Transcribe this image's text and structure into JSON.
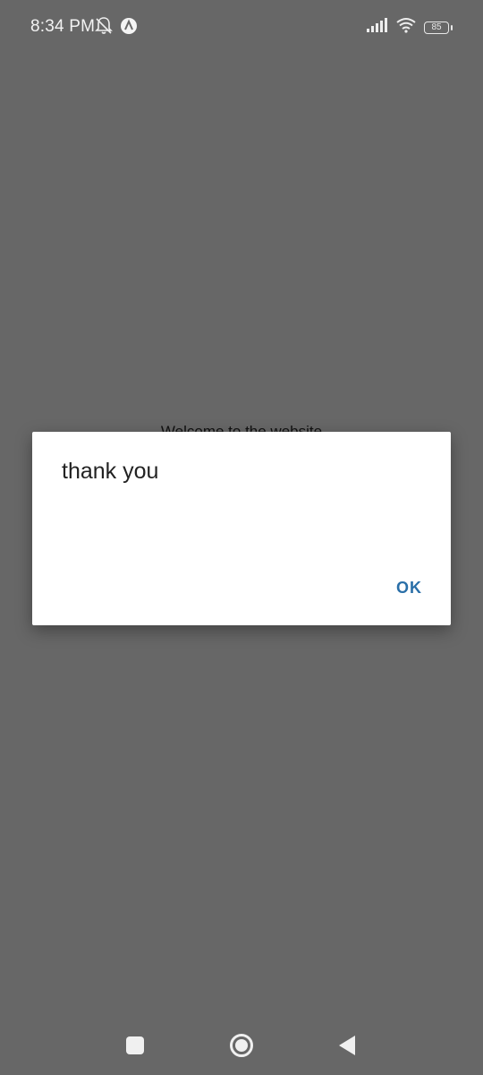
{
  "status_bar": {
    "time": "8:34 PM",
    "battery_level": "85",
    "icons": [
      "bell-off-icon",
      "app-notification-icon",
      "signal-icon",
      "wifi-icon",
      "battery-icon"
    ]
  },
  "background": {
    "welcome_text": "Welcome to the website"
  },
  "dialog": {
    "message": "thank you",
    "ok_label": "OK"
  },
  "nav_bar": {
    "icons": [
      "recents-icon",
      "home-icon",
      "back-icon"
    ]
  },
  "colors": {
    "scrim": "#676767",
    "dialog_bg": "#ffffff",
    "accent": "#2a6fa8",
    "text": "#222222"
  }
}
